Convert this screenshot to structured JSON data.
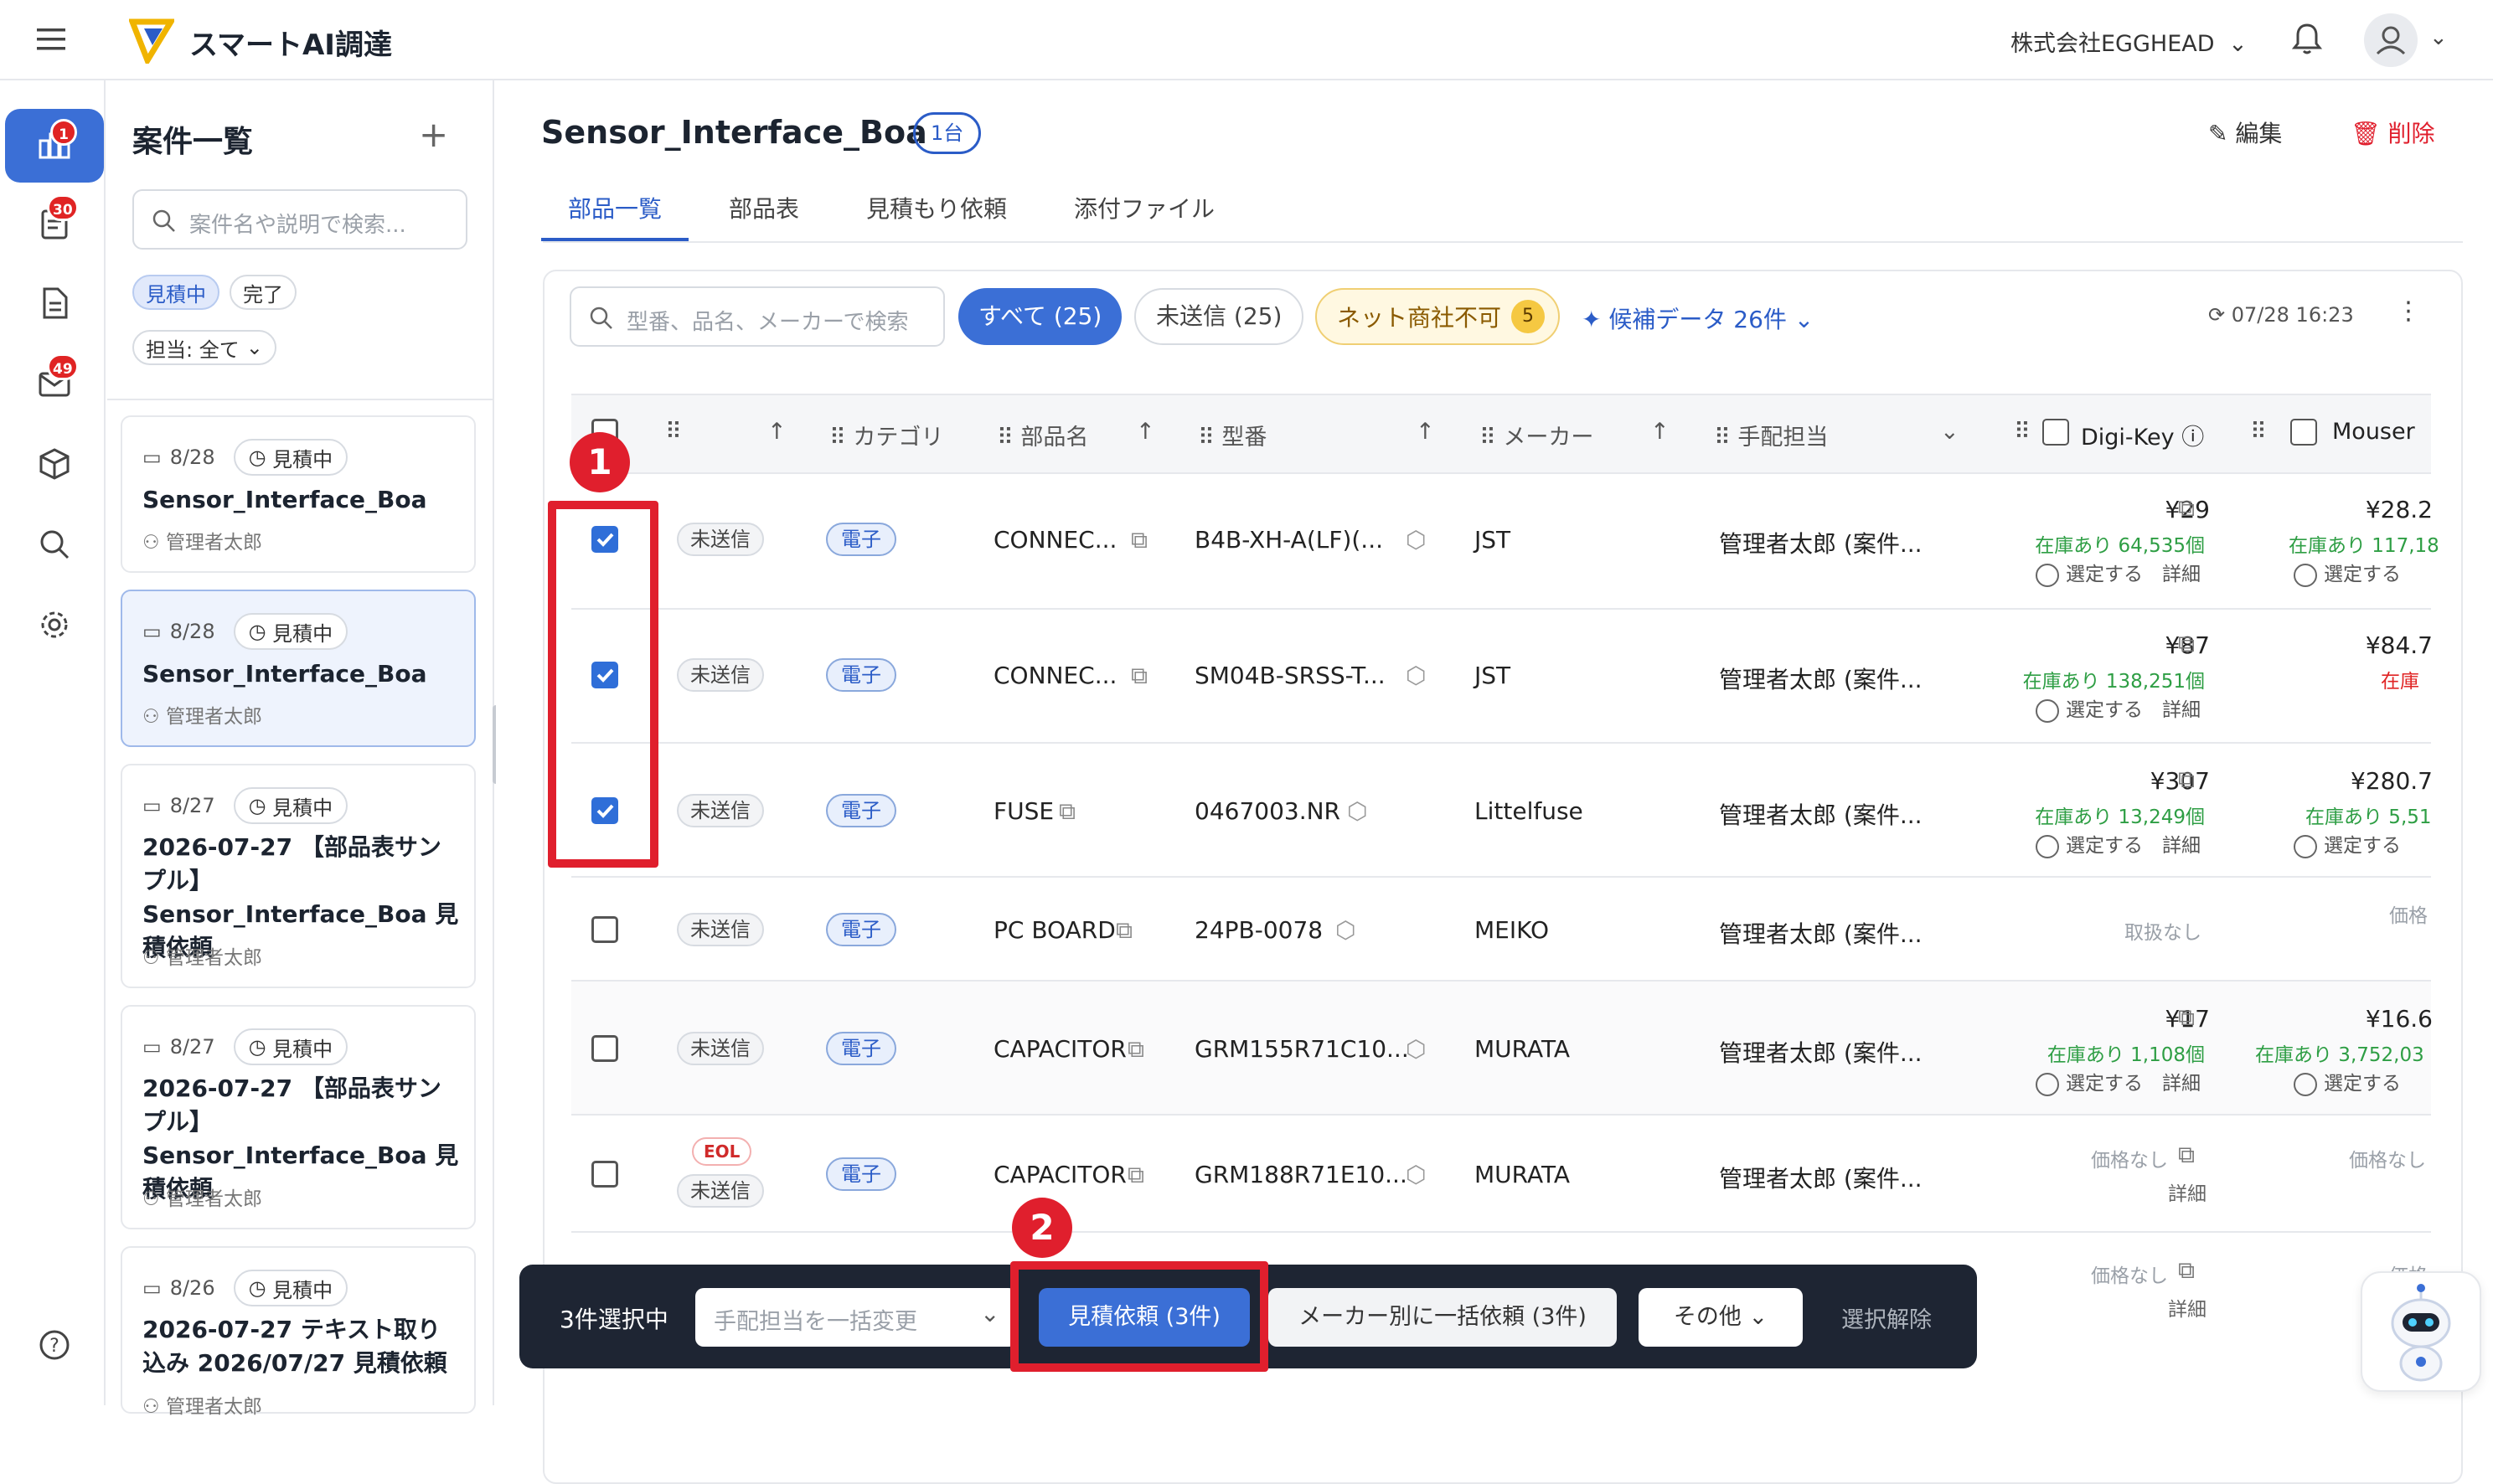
{
  "app": {
    "logo_text": "スマートAI調達",
    "company": "株式会社EGGHEAD"
  },
  "rail": {
    "badges": {
      "projects": "1",
      "docs": "30",
      "inbox": "49"
    }
  },
  "sidebar": {
    "title": "案件一覧",
    "search_placeholder": "案件名や説明で検索...",
    "filters": [
      "見積中",
      "完了"
    ],
    "assignee_filter": "担当: 全て",
    "cards": [
      {
        "date": "8/28",
        "status": "見積中",
        "title": "Sensor_Interface_Boa",
        "owner": "管理者太郎"
      },
      {
        "date": "8/28",
        "status": "見積中",
        "title": "Sensor_Interface_Boa",
        "owner": "管理者太郎"
      },
      {
        "date": "8/27",
        "status": "見積中",
        "title": "2026-07-27 【部品表サンプル】Sensor_Interface_Boa 見積依頼",
        "owner": "管理者太郎"
      },
      {
        "date": "8/27",
        "status": "見積中",
        "title": "2026-07-27 【部品表サンプル】Sensor_Interface_Boa 見積依頼",
        "owner": "管理者太郎"
      },
      {
        "date": "8/26",
        "status": "見積中",
        "title": "2026-07-27 テキスト取り込み 2026/07/27 見積依頼",
        "owner": "管理者太郎"
      }
    ]
  },
  "project": {
    "title": "Sensor_Interface_Boa",
    "unit_badge": "1台",
    "edit": "編集",
    "delete": "削除"
  },
  "tabs": [
    "部品一覧",
    "部品表",
    "見積もり依頼",
    "添付ファイル"
  ],
  "toolbar": {
    "search_placeholder": "型番、品名、メーカーで検索",
    "all": "すべて (25)",
    "unsent": "未送信 (25)",
    "ng_label": "ネット商社不可",
    "ng_count": "5",
    "candidates": "候補データ 26件",
    "timestamp": "07/28 16:23"
  },
  "columns": {
    "category": "カテゴリ",
    "part_name": "部品名",
    "part_no": "型番",
    "maker": "メーカー",
    "assignee": "手配担当",
    "digikey": "Digi-Key",
    "mouser": "Mouser"
  },
  "rows": [
    {
      "checked": true,
      "status": "未送信",
      "eol": "",
      "category": "電子",
      "name": "CONNEC...",
      "pn": "B4B-XH-A(LF)(...",
      "maker": "JST",
      "assignee": "管理者太郎 (案件...",
      "dk_price": "¥29",
      "dk_stock": "在庫あり 64,535個",
      "ms_price": "¥28.2",
      "ms_stock": "在庫あり 117,18",
      "select": "選定する",
      "detail": "詳細",
      "ms_red": false
    },
    {
      "checked": true,
      "status": "未送信",
      "eol": "",
      "category": "電子",
      "name": "CONNEC...",
      "pn": "SM04B-SRSS-T...",
      "maker": "JST",
      "assignee": "管理者太郎 (案件...",
      "dk_price": "¥87",
      "dk_stock": "在庫あり 138,251個",
      "ms_price": "¥84.7",
      "ms_stock": "在庫",
      "select": "選定する",
      "detail": "詳細",
      "ms_red": true
    },
    {
      "checked": true,
      "status": "未送信",
      "eol": "",
      "category": "電子",
      "name": "FUSE",
      "pn": "0467003.NR",
      "maker": "Littelfuse",
      "assignee": "管理者太郎 (案件...",
      "dk_price": "¥307",
      "dk_stock": "在庫あり 13,249個",
      "ms_price": "¥280.7",
      "ms_stock": "在庫あり 5,51",
      "select": "選定する",
      "detail": "詳細",
      "ms_red": false
    },
    {
      "checked": false,
      "status": "未送信",
      "eol": "",
      "category": "電子",
      "name": "PC BOARD",
      "pn": "24PB-0078",
      "maker": "MEIKO",
      "assignee": "管理者太郎 (案件...",
      "dk_none": "取扱なし",
      "ms_none": "価格"
    },
    {
      "checked": false,
      "status": "未送信",
      "eol": "",
      "category": "電子",
      "name": "CAPACITOR",
      "pn": "GRM155R71C10...",
      "maker": "MURATA",
      "assignee": "管理者太郎 (案件...",
      "dk_price": "¥17",
      "dk_stock": "在庫あり 1,108個",
      "ms_price": "¥16.6",
      "ms_stock": "在庫あり 3,752,03",
      "select": "選定する",
      "detail": "詳細",
      "ms_red": false
    },
    {
      "checked": false,
      "status": "未送信",
      "eol": "EOL",
      "category": "電子",
      "name": "CAPACITOR",
      "pn": "GRM188R71E10...",
      "maker": "MURATA",
      "assignee": "管理者太郎 (案件...",
      "dk_none": "価格なし",
      "ms_none": "価格なし",
      "detail": "詳細"
    }
  ],
  "partial_row": {
    "dk_none": "価格なし",
    "ms_none": "価格",
    "detail": "詳細"
  },
  "actionbar": {
    "selected": "3件選択中",
    "assignee_placeholder": "手配担当を一括変更",
    "request": "見積依頼 (3件)",
    "by_maker": "メーカー別に一括依頼 (3件)",
    "other": "その他",
    "clear": "選択解除"
  },
  "annotations": {
    "step1": "1",
    "step2": "2"
  },
  "colors": {
    "accent": "#2f6ed8",
    "danger": "#e01f2d",
    "stock": "#2e9e44",
    "bar": "#1e2533"
  }
}
